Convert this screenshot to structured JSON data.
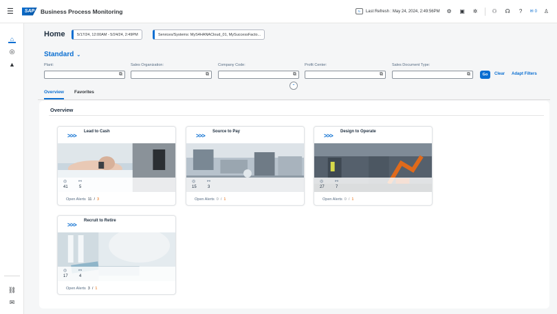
{
  "shell": {
    "title": "Business Process Monitoring",
    "logo": "SAP",
    "last_refresh": "Last Refresh : May 24, 2024, 2:49:56PM",
    "notification_count": "0",
    "icons": [
      "menu-icon",
      "refresh-icon",
      "settings-icon",
      "calendar-icon",
      "gear-icon",
      "people-icon",
      "headset-icon",
      "help-icon",
      "notification-icon",
      "user-icon"
    ]
  },
  "header": {
    "title": "Home",
    "date_chip": "5/17/24, 12:00AM - 5/24/24, 2:49PM",
    "systems_chip": "Services/Systems: MyS4HANACloud_01, MySuccessFacto..."
  },
  "filterbar": {
    "variant": "Standard",
    "fields": [
      {
        "label": "Plant:",
        "value": ""
      },
      {
        "label": "Sales Organization:",
        "value": ""
      },
      {
        "label": "Company Code:",
        "value": ""
      },
      {
        "label": "Profit Center:",
        "value": ""
      },
      {
        "label": "Sales Document Type:",
        "value": ""
      }
    ],
    "go": "Go",
    "clear": "Clear",
    "adapt": "Adapt Filters"
  },
  "tabs": [
    "Overview",
    "Favorites"
  ],
  "section_title": "Overview",
  "cards": [
    {
      "title": "Lead to Cash",
      "a": "41",
      "b": "5",
      "alerts_label": "Open Alerts",
      "alerts_open": "11",
      "alerts_sep": "/",
      "alerts_total": "3"
    },
    {
      "title": "Source to Pay",
      "a": "15",
      "b": "3",
      "alerts_label": "Open Alerts",
      "alerts_open": "0",
      "alerts_sep": "/",
      "alerts_total": "1"
    },
    {
      "title": "Design to Operate",
      "a": "27",
      "b": "7",
      "alerts_label": "Open Alerts",
      "alerts_open": "0",
      "alerts_sep": "/",
      "alerts_total": "1"
    },
    {
      "title": "Recruit to Retire",
      "a": "17",
      "b": "4",
      "alerts_label": "Open Alerts",
      "alerts_open": "3",
      "alerts_sep": "/",
      "alerts_total": "1"
    }
  ],
  "colors": {
    "accent": "#0a6ed1",
    "warning": "#e76500"
  }
}
